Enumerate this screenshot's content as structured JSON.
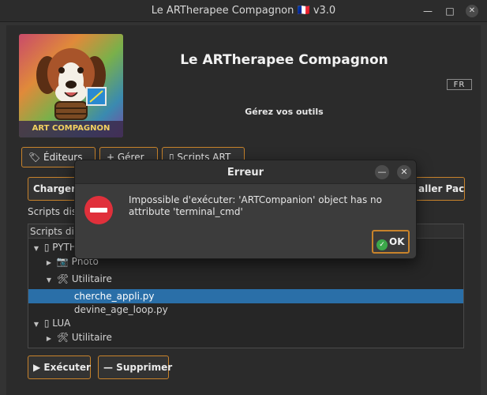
{
  "window": {
    "title": "Le ARTherapee Compagnon 🇫🇷 v3.0",
    "minimize_glyph": "—",
    "maximize_glyph": "□",
    "close_glyph": "✕"
  },
  "header": {
    "app_title": "Le ARTherapee Compagnon",
    "subtitle": "Gérez vos outils",
    "lang_badge": "FR",
    "logo_caption": "ART COMPAGNON"
  },
  "tabs": [
    {
      "label": "🏷 Éditeurs"
    },
    {
      "label": "+ Gérer"
    },
    {
      "label": "▯ Scripts ART"
    }
  ],
  "actions": {
    "load_label": "Charger",
    "install_pack_label": "aller Pack"
  },
  "labels": {
    "scripts_label": "Scripts dis",
    "tree_header": "Scripts dis"
  },
  "tree": {
    "rows": [
      {
        "text": "PYTH",
        "prefix": "▼",
        "icon": "▯"
      },
      {
        "text": "Photo",
        "prefix": "▶",
        "icon": "📷"
      },
      {
        "text": "Utilitaire",
        "prefix": "▼",
        "icon": "🛠"
      },
      {
        "text": "cherche_appli.py",
        "prefix": "",
        "icon": ""
      },
      {
        "text": "devine_age_loop.py",
        "prefix": "",
        "icon": ""
      },
      {
        "text": "LUA",
        "prefix": "▼",
        "icon": "▯"
      },
      {
        "text": "Utilitaire",
        "prefix": "▶",
        "icon": "🛠"
      }
    ]
  },
  "bottom": {
    "execute_label": "▶ Exécuter",
    "delete_label": "— Supprimer"
  },
  "dialog": {
    "title": "Erreur",
    "message": "Impossible d'exécuter: 'ARTCompanion' object has no attribute 'terminal_cmd'",
    "ok_label": "OK",
    "minimize_glyph": "—",
    "close_glyph": "✕"
  },
  "colors": {
    "accent_border": "#c8832b",
    "selection": "#2a6fa8",
    "error_red": "#e0303b",
    "ok_green": "#3ca84a"
  }
}
